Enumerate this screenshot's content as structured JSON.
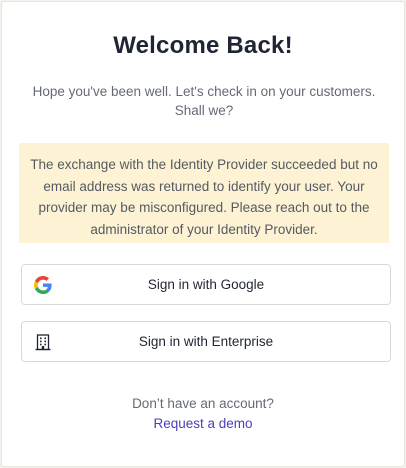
{
  "header": {
    "title": "Welcome Back!",
    "subtitle": "Hope you've been well. Let's check in on your customers. Shall we?"
  },
  "alert": {
    "message": "The exchange with the Identity Provider succeeded but no email address was returned to identify your user. Your provider may be misconfigured. Please reach out to the administrator of your Identity Provider.",
    "background_color": "#fdf2d3"
  },
  "buttons": {
    "google": {
      "label": "Sign in with Google",
      "icon": "google-icon"
    },
    "enterprise": {
      "label": "Sign in with Enterprise",
      "icon": "building-icon"
    }
  },
  "footer": {
    "prompt": "Don’t have an account?",
    "link_label": "Request a demo",
    "link_color": "#4a41b8"
  }
}
